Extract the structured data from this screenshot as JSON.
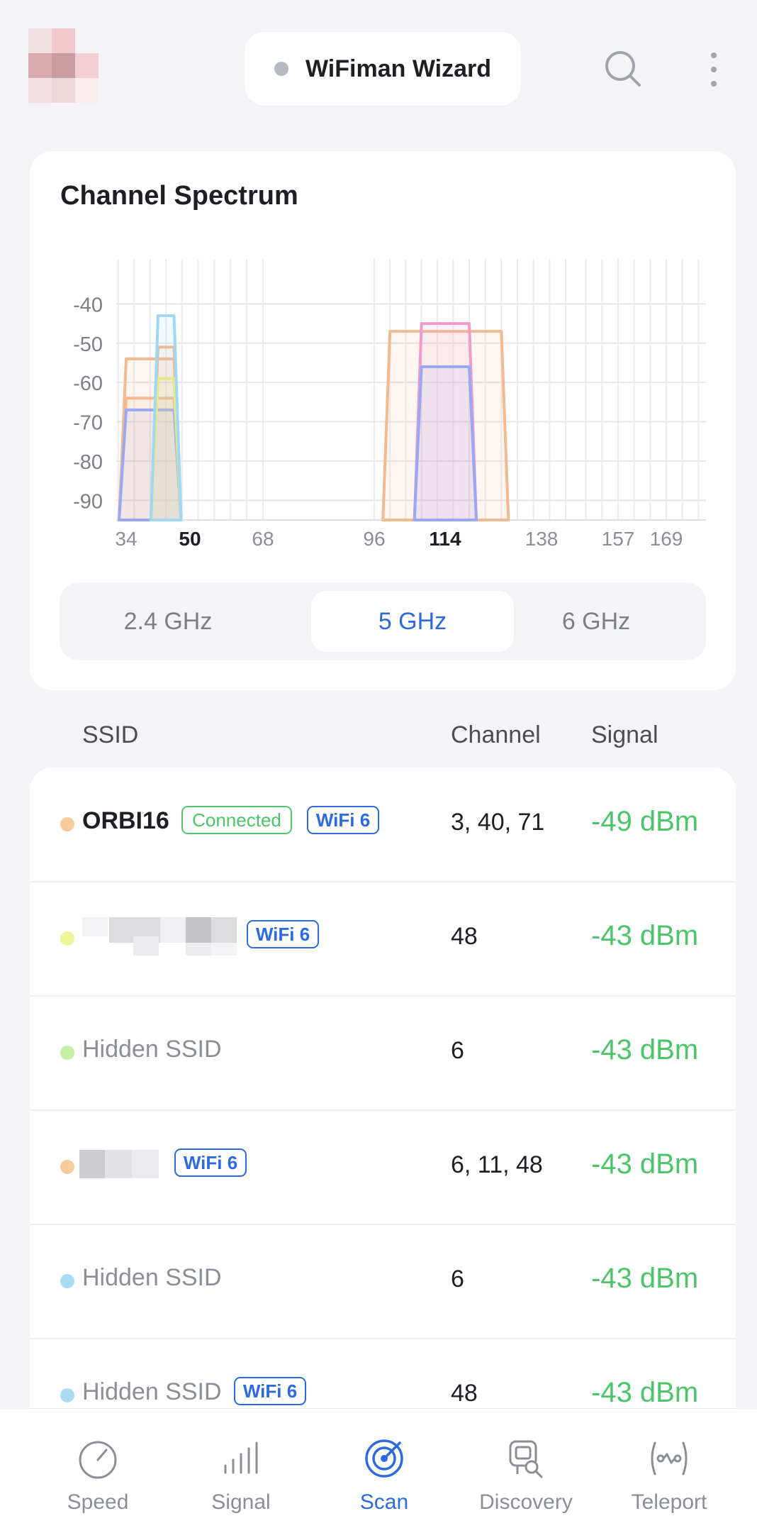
{
  "header": {
    "title": "WiFiman Wizard",
    "status_color": "#b7bac1",
    "search_icon": "search-icon",
    "more_icon": "more-vertical-icon"
  },
  "spectrum": {
    "title": "Channel Spectrum",
    "bands": [
      {
        "label": "2.4 GHz",
        "active": false
      },
      {
        "label": "5 GHz",
        "active": true
      },
      {
        "label": "6 GHz",
        "active": false
      }
    ]
  },
  "chart_data": {
    "type": "area",
    "title": "",
    "xlabel": "",
    "ylabel": "",
    "yticks": [
      "-40",
      "-50",
      "-60",
      "-70",
      "-80",
      "-90"
    ],
    "ylim": [
      -95,
      -30
    ],
    "xticks": [
      {
        "label": "34",
        "bold": false
      },
      {
        "label": "50",
        "bold": true
      },
      {
        "label": "68",
        "bold": false
      },
      {
        "label": "96",
        "bold": false
      },
      {
        "label": "114",
        "bold": true
      },
      {
        "label": "138",
        "bold": false
      },
      {
        "label": "157",
        "bold": false
      },
      {
        "label": "169",
        "bold": false
      }
    ],
    "grid": true,
    "series": [
      {
        "color": "#f3b98f",
        "channel_from": 34,
        "channel_to": 46,
        "dbm": -54
      },
      {
        "color": "#f3b98f",
        "channel_from": 34,
        "channel_to": 46,
        "dbm": -64
      },
      {
        "color": "#9aa8f2",
        "channel_from": 34,
        "channel_to": 46,
        "dbm": -67
      },
      {
        "color": "#f3b98f",
        "channel_from": 42,
        "channel_to": 46,
        "dbm": -51
      },
      {
        "color": "#f0ec7a",
        "channel_from": 42,
        "channel_to": 46,
        "dbm": -59
      },
      {
        "color": "#9ed8f2",
        "channel_from": 42,
        "channel_to": 46,
        "dbm": -43
      },
      {
        "color": "#f3b98f",
        "channel_from": 100,
        "channel_to": 128,
        "dbm": -47
      },
      {
        "color": "#ef9bcc",
        "channel_from": 108,
        "channel_to": 120,
        "dbm": -45
      },
      {
        "color": "#9aa8f2",
        "channel_from": 108,
        "channel_to": 120,
        "dbm": -56
      }
    ]
  },
  "list": {
    "headers": {
      "ssid": "SSID",
      "channel": "Channel",
      "signal": "Signal"
    },
    "rows": [
      {
        "ssid": "ORBI16",
        "dot": "#f7cb9c",
        "connected": "Connected",
        "wifi": "WiFi 6",
        "channel": "3, 40, 71",
        "signal": "-49 dBm"
      },
      {
        "ssid": "",
        "dot": "#eef59a",
        "wifi": "WiFi 6",
        "channel": "48",
        "signal": "-43 dBm"
      },
      {
        "ssid": "Hidden SSID",
        "dot": "#c4f0a6",
        "channel": "6",
        "signal": "-43 dBm"
      },
      {
        "ssid": "",
        "dot": "#f7cb9c",
        "wifi": "WiFi 6",
        "channel": "6, 11, 48",
        "signal": "-43 dBm"
      },
      {
        "ssid": "Hidden SSID",
        "dot": "#a9dcf3",
        "channel": "6",
        "signal": "-43 dBm"
      },
      {
        "ssid": "Hidden SSID",
        "dot": "#a9dcf3",
        "wifi": "WiFi 6",
        "channel": "48",
        "signal": "-43 dBm"
      }
    ]
  },
  "tabs": [
    {
      "label": "Speed",
      "icon": "gauge-icon",
      "active": false
    },
    {
      "label": "Signal",
      "icon": "signal-bars-icon",
      "active": false
    },
    {
      "label": "Scan",
      "icon": "radar-icon",
      "active": true
    },
    {
      "label": "Discovery",
      "icon": "discovery-icon",
      "active": false
    },
    {
      "label": "Teleport",
      "icon": "teleport-icon",
      "active": false
    }
  ],
  "colors": {
    "accent": "#2d6ae0",
    "signal_good": "#4cc46a",
    "connected": "#54c66b"
  }
}
